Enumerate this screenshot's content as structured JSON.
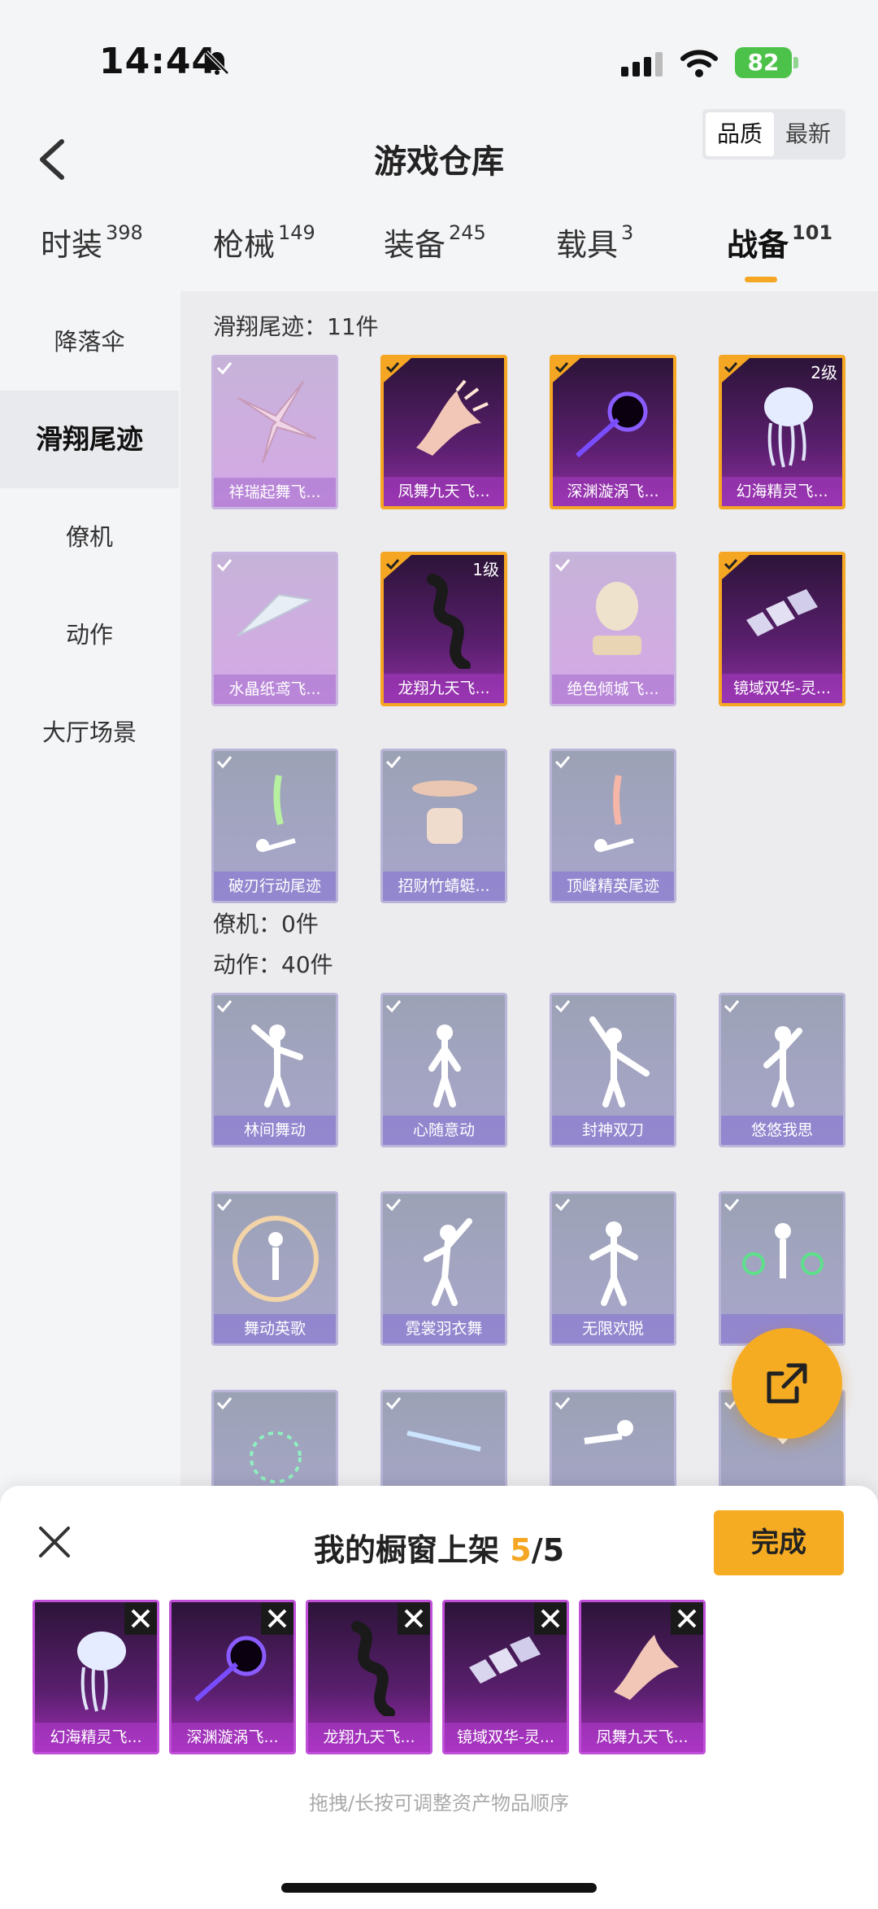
{
  "status": {
    "time": "14:44",
    "battery": "82"
  },
  "header": {
    "title": "游戏仓库",
    "sort_quality": "品质",
    "sort_newest": "最新"
  },
  "tabs": [
    {
      "label": "时装",
      "count": "398"
    },
    {
      "label": "枪械",
      "count": "149"
    },
    {
      "label": "装备",
      "count": "245"
    },
    {
      "label": "载具",
      "count": "3"
    },
    {
      "label": "战备",
      "count": "101"
    }
  ],
  "sidebar": {
    "items": [
      {
        "label": "降落伞"
      },
      {
        "label": "滑翔尾迹"
      },
      {
        "label": "僚机"
      },
      {
        "label": "动作"
      },
      {
        "label": "大厅场景"
      }
    ]
  },
  "sections": {
    "glide": {
      "label": "滑翔尾迹：11件",
      "items": [
        {
          "name": "祥瑞起舞飞..."
        },
        {
          "name": "凤舞九天飞..."
        },
        {
          "name": "深渊漩涡飞..."
        },
        {
          "name": "幻海精灵飞...",
          "level": "2级"
        },
        {
          "name": "水晶纸鸢飞..."
        },
        {
          "name": "龙翔九天飞...",
          "level": "1级"
        },
        {
          "name": "绝色倾城飞..."
        },
        {
          "name": "镜域双华-灵..."
        },
        {
          "name": "破刃行动尾迹"
        },
        {
          "name": "招财竹蜻蜓..."
        },
        {
          "name": "顶峰精英尾迹"
        }
      ]
    },
    "wingman": {
      "label": "僚机：0件"
    },
    "emotes": {
      "label": "动作：40件",
      "items": [
        {
          "name": "林间舞动"
        },
        {
          "name": "心随意动"
        },
        {
          "name": "封神双刀"
        },
        {
          "name": "悠悠我思"
        },
        {
          "name": "舞动英歌"
        },
        {
          "name": "霓裳羽衣舞"
        },
        {
          "name": "无限欢脱"
        },
        {
          "name": ""
        }
      ]
    }
  },
  "sheet": {
    "title": "我的橱窗上架",
    "count": "5",
    "total": "/5",
    "done": "完成",
    "slots": [
      {
        "name": "幻海精灵飞..."
      },
      {
        "name": "深渊漩涡飞..."
      },
      {
        "name": "龙翔九天飞..."
      },
      {
        "name": "镜域双华-灵..."
      },
      {
        "name": "凤舞九天飞..."
      }
    ],
    "hint": "拖拽/长按可调整资产物品顺序"
  }
}
